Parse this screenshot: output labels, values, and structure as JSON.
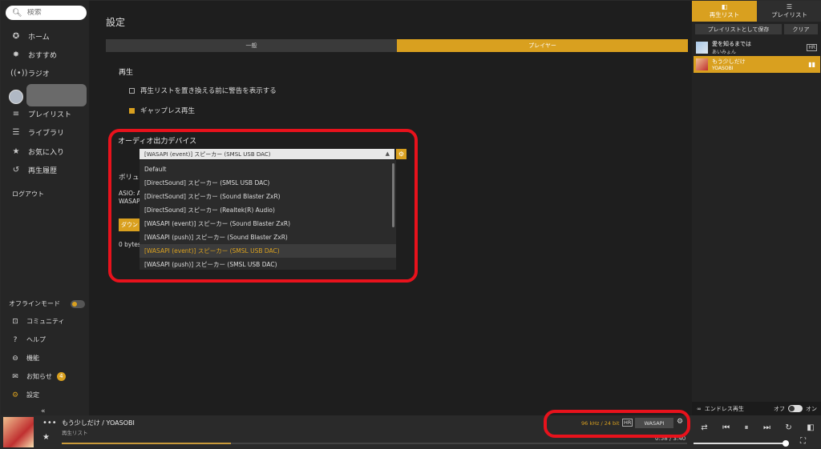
{
  "sidebar": {
    "search_placeholder": "検索",
    "items": [
      {
        "label": "ホーム",
        "icon": "compass-icon"
      },
      {
        "label": "おすすめ",
        "icon": "sparkle-icon"
      },
      {
        "label": "ラジオ",
        "icon": "radio-icon"
      },
      {
        "label": "プレイリスト",
        "icon": "playlist-icon"
      },
      {
        "label": "ライブラリ",
        "icon": "library-icon"
      },
      {
        "label": "お気に入り",
        "icon": "star-icon"
      },
      {
        "label": "再生履歴",
        "icon": "history-icon"
      }
    ],
    "logout": "ログアウト",
    "offline_mode": "オフラインモード",
    "bottom_items": [
      {
        "label": "コミュニティ",
        "icon": "community-icon"
      },
      {
        "label": "ヘルプ",
        "icon": "help-icon"
      },
      {
        "label": "機能",
        "icon": "features-icon"
      },
      {
        "label": "お知らせ",
        "icon": "mail-icon",
        "badge": "4"
      },
      {
        "label": "設定",
        "icon": "gear-icon"
      }
    ],
    "collapse": "«"
  },
  "main": {
    "title": "設定",
    "tabs": [
      "一般",
      "プレイヤー"
    ],
    "playback_section": "再生",
    "option_warn": "再生リストを置き換える前に警告を表示する",
    "option_gapless": "ギャップレス再生",
    "audio_section": "オーディオ出力デバイス",
    "selected_device": "[WASAPI (event)] スピーカー (SMSL USB DAC)",
    "volume_partial": "ボリュ",
    "asio_partial": "ASIO: A",
    "wasap_partial": "WASAP",
    "download_partial": "ダウン",
    "bytes_partial": "0 bytes",
    "devices": [
      "Default",
      "[DirectSound] スピーカー (SMSL USB DAC)",
      "[DirectSound] スピーカー (Sound Blaster ZxR)",
      "[DirectSound] スピーカー (Realtek(R) Audio)",
      "[WASAPI (event)] スピーカー (Sound Blaster ZxR)",
      "[WASAPI (push)] スピーカー (Sound Blaster ZxR)",
      "[WASAPI (event)] スピーカー (SMSL USB DAC)",
      "[WASAPI (push)] スピーカー (SMSL USB DAC)"
    ],
    "selected_index": 6
  },
  "right_panel": {
    "tab_playing": "再生リスト",
    "tab_playlist": "プレイリスト",
    "save_playlist": "プレイリストとして保存",
    "clear": "クリア",
    "tracks": [
      {
        "title": "愛を知るまでは",
        "artist": "あいみょん",
        "hr": "HR"
      },
      {
        "title": "もう少しだけ",
        "artist": "YOASOBI"
      }
    ],
    "endless": "エンドレス再生",
    "off": "オフ",
    "on": "オン"
  },
  "player": {
    "title": "もう少しだけ / YOASOBI",
    "sub": "再生リスト",
    "rate": "96 kHz / 24 bit",
    "hr": "HR",
    "output": "WASAPI",
    "time": "0:58 / 3:40",
    "progress": 0.27
  },
  "colors": {
    "accent": "#d9a01f",
    "highlight_box": "#e8121c"
  }
}
